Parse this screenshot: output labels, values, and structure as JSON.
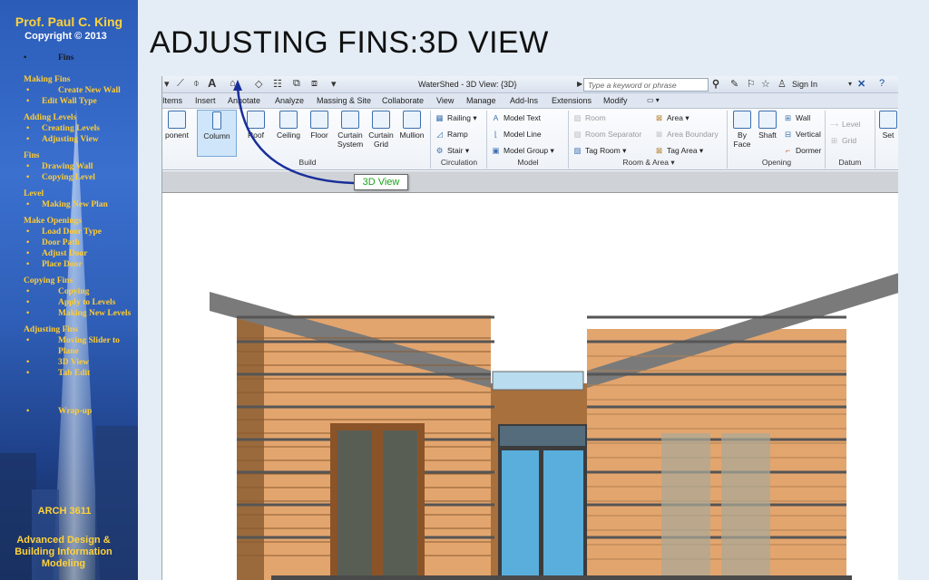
{
  "sidebar": {
    "author": "Prof. Paul C. King",
    "copyright": "Copyright © 2013",
    "current": "Fins",
    "nav": [
      {
        "group": "Making Fins",
        "items": [
          {
            "label": "Create New Wall",
            "deep": true
          },
          {
            "label": "Edit Wall Type",
            "deep": false
          }
        ]
      },
      {
        "group": "Adding Levels",
        "items": [
          {
            "label": "Creating Levels",
            "deep": false
          },
          {
            "label": "Adjusting View",
            "deep": false
          }
        ]
      },
      {
        "group": "Fins",
        "items": [
          {
            "label": "Drawing Wall",
            "deep": false
          },
          {
            "label": "Copying Level",
            "deep": false
          }
        ]
      },
      {
        "group": "Level",
        "items": [
          {
            "label": "Making New Plan",
            "deep": false
          }
        ]
      },
      {
        "group": "Make Openings",
        "items": [
          {
            "label": "Load Door Type",
            "deep": false
          },
          {
            "label": "Door Path",
            "deep": false
          },
          {
            "label": "Adjust Door",
            "deep": false
          },
          {
            "label": "Place Door",
            "deep": false
          }
        ]
      },
      {
        "group": "Copying Fins",
        "items": [
          {
            "label": "Copying",
            "deep": true
          },
          {
            "label": "Apply to Levels",
            "deep": true
          },
          {
            "label": "Making New Levels",
            "deep": true
          }
        ]
      },
      {
        "group": "Adjusting Fins",
        "items": [
          {
            "label": "Moving Slider to Plane",
            "deep": true
          },
          {
            "label": "3D View",
            "deep": true
          },
          {
            "label": "Tab Edit",
            "deep": true
          }
        ]
      }
    ],
    "wrapup": "Wrap-up",
    "course": "ARCH 3611",
    "subtitle": "Advanced Design & Building Information Modeling"
  },
  "slide_title": "ADJUSTING FINS:3D VIEW",
  "revit": {
    "window_title": "WaterShed - 3D View: {3D}",
    "search_placeholder": "Type a keyword or phrase",
    "sign_in": "Sign In",
    "tabs": [
      "Items",
      "Insert",
      "Annotate",
      "Analyze",
      "Massing & Site",
      "Collaborate",
      "View",
      "Manage",
      "Add-Ins",
      "Extensions",
      "Modify"
    ],
    "build_buttons": [
      "ponent",
      "Column",
      "Roof",
      "Ceiling",
      "Floor",
      "Curtain System",
      "Curtain Grid",
      "Mullion"
    ],
    "circulation": [
      "Railing",
      "Ramp",
      "Stair"
    ],
    "model": [
      "Model Text",
      "Model Line",
      "Model Group"
    ],
    "room_area": [
      "Room",
      "Room Separator",
      "Tag Room",
      "Area",
      "Area Boundary",
      "Tag Area"
    ],
    "opening": [
      "By Face",
      "Shaft",
      "Wall",
      "Vertical",
      "Dormer"
    ],
    "datum": [
      "Level",
      "Grid"
    ],
    "set_label": "Set",
    "groups": [
      "Build",
      "Circulation",
      "Model",
      "Room & Area",
      "Opening",
      "Datum"
    ],
    "callout": "3D View"
  },
  "colors": {
    "accent": "#ffd23a",
    "siding": "#e3a56e",
    "glass": "#5aaedc",
    "roof": "#7a7a7a"
  }
}
